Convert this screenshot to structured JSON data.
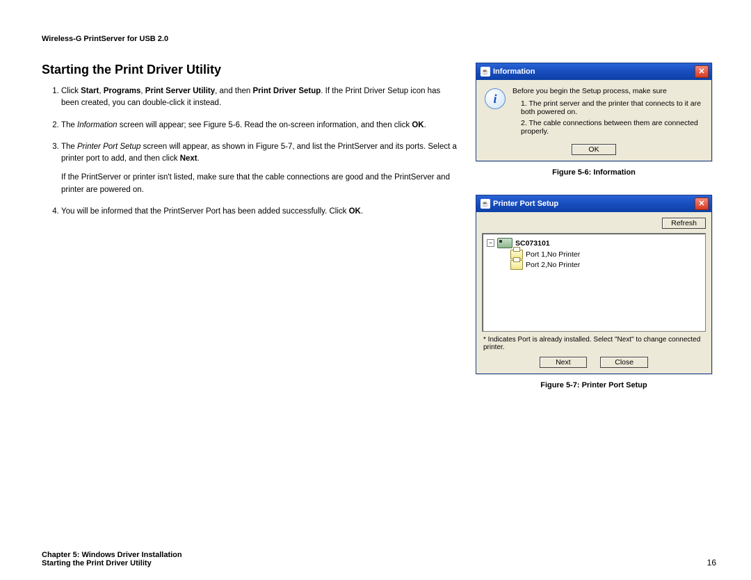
{
  "header": {
    "product": "Wireless-G PrintServer for USB 2.0"
  },
  "section": {
    "title": "Starting the Print Driver Utility"
  },
  "steps": {
    "s1a": "Click ",
    "s1_start": "Start",
    "s1b": ", ",
    "s1_programs": "Programs",
    "s1c": ", ",
    "s1_psu": "Print Server Utility",
    "s1d": ", and then ",
    "s1_pds": "Print Driver Setup",
    "s1e": ". If the Print Driver Setup icon has been created, you can double-click it instead.",
    "s2a": "The ",
    "s2_info": "Information",
    "s2b": " screen will appear; see Figure 5-6. Read the on-screen information, and then click ",
    "s2_ok": "OK",
    "s2c": ".",
    "s3a": "The ",
    "s3_pps": "Printer Port Setup",
    "s3b": " screen will appear, as shown in Figure 5-7, and list the PrintServer and its ports. Select a printer port to add, and then click ",
    "s3_next": "Next",
    "s3c": ".",
    "s3_sub": "If the PrintServer or printer isn't listed, make sure that the cable connections are good and the PrintServer and printer are powered on.",
    "s4a": "You will be informed that the PrintServer Port has been added successfully. Click ",
    "s4_ok": "OK",
    "s4b": "."
  },
  "fig1": {
    "title": "Information",
    "lead": "Before you begin the Setup process, make sure",
    "pt1": "1. The print server and the printer that connects to it are both powered on.",
    "pt2": "2. The cable connections between them are connected properly.",
    "ok": "OK",
    "caption": "Figure 5-6: Information"
  },
  "fig2": {
    "title": "Printer Port Setup",
    "refresh": "Refresh",
    "server": "SC073101",
    "port1": "Port 1,No Printer",
    "port2": "Port 2,No Printer",
    "note": "* Indicates Port is already installed. Select \"Next\" to change connected printer.",
    "next": "Next",
    "close": "Close",
    "caption": "Figure 5-7: Printer Port Setup"
  },
  "footer": {
    "chapter": "Chapter 5: Windows Driver Installation",
    "section": "Starting the Print Driver Utility",
    "page": "16"
  }
}
